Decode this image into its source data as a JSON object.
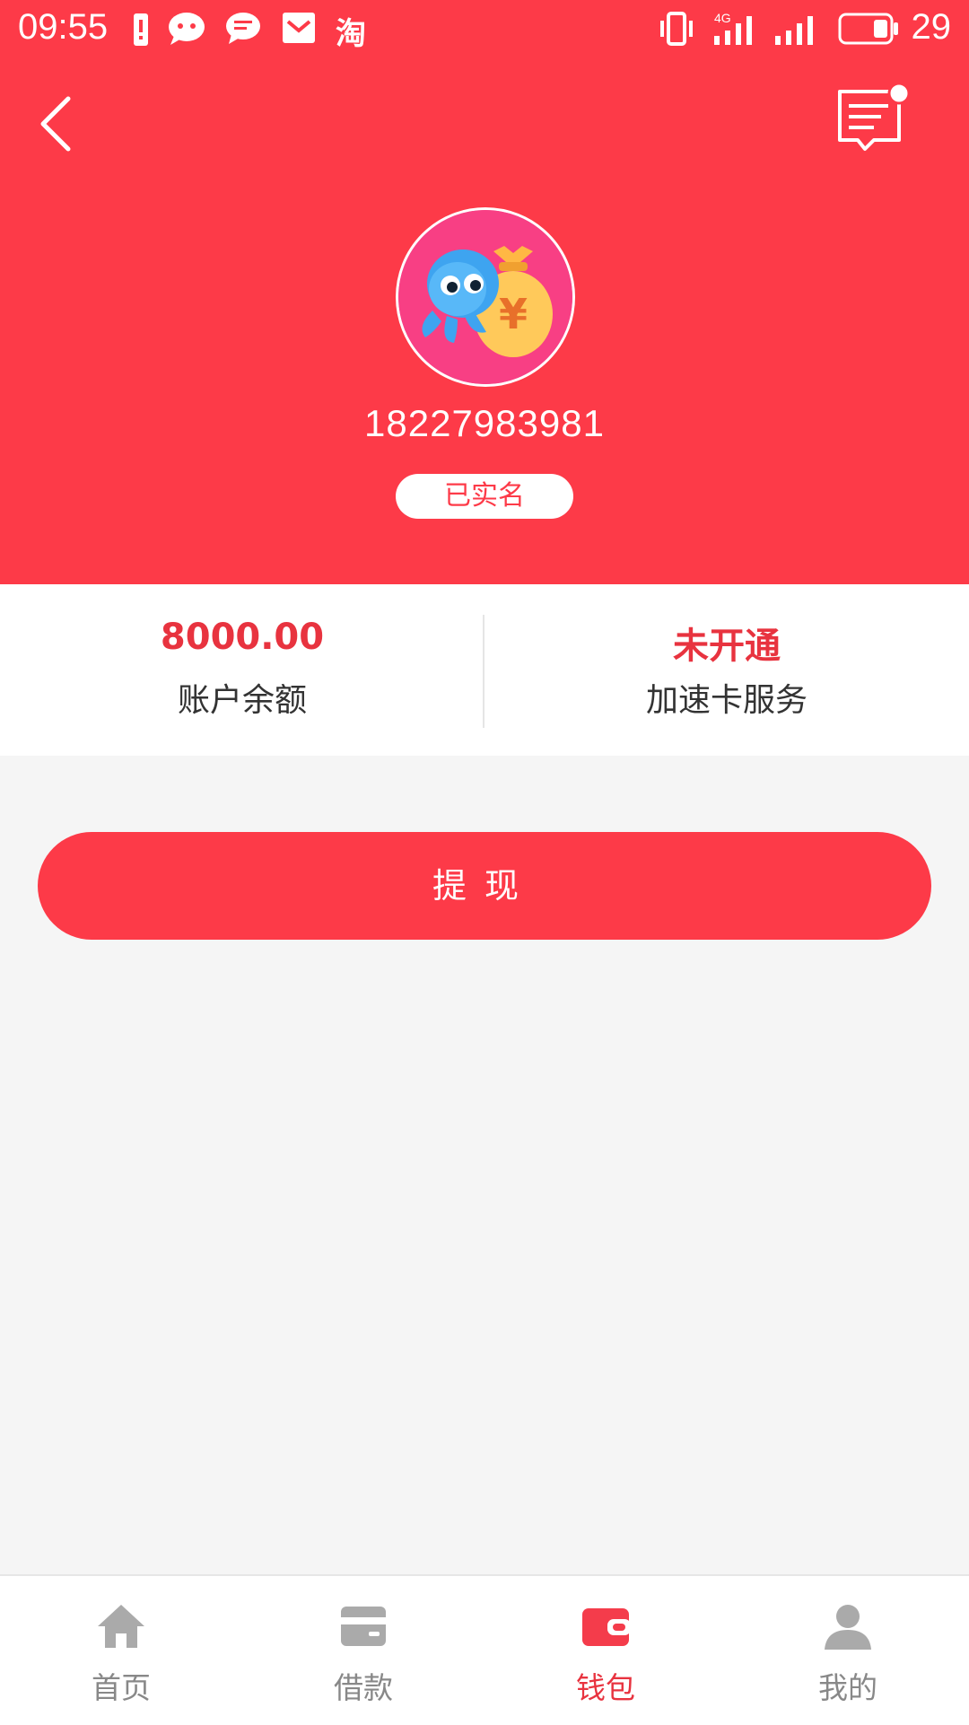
{
  "status_bar": {
    "time": "09:55",
    "notification_taobao": "淘",
    "battery_level": "29",
    "network_label": "4G"
  },
  "header": {
    "phone": "18227983981",
    "verified_badge": "已实名",
    "avatar_yuan": "¥"
  },
  "info": {
    "balance_value": "8000.00",
    "balance_label": "账户余额",
    "card_status": "未开通",
    "card_label": "加速卡服务"
  },
  "actions": {
    "withdraw_label": "提现"
  },
  "tabbar": {
    "items": [
      {
        "label": "首页",
        "icon": "home-icon"
      },
      {
        "label": "借款",
        "icon": "card-icon"
      },
      {
        "label": "钱包",
        "icon": "wallet-icon"
      },
      {
        "label": "我的",
        "icon": "person-icon"
      }
    ],
    "active_index": 2
  },
  "colors": {
    "brand": "#fd3a48",
    "accent_text": "#e8333f",
    "inactive": "#aaaaaa"
  }
}
